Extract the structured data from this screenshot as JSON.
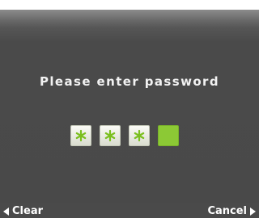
{
  "dialog": {
    "prompt": "Please enter password",
    "pin_slots": [
      {
        "state": "filled",
        "glyph": "asterisk-icon"
      },
      {
        "state": "filled",
        "glyph": "asterisk-icon"
      },
      {
        "state": "filled",
        "glyph": "asterisk-icon"
      },
      {
        "state": "active",
        "glyph": ""
      }
    ],
    "entered_count": 3,
    "total_slots": 4
  },
  "softkeys": {
    "left_label": "Clear",
    "right_label": "Cancel"
  },
  "colors": {
    "background": "#4a4a4a",
    "active_slot": "#8cc935",
    "asterisk": "#7bbf1f",
    "text": "#f2f2f2"
  }
}
